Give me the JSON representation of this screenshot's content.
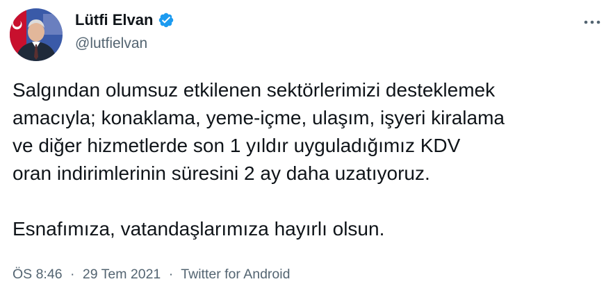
{
  "author": {
    "name": "Lütfi Elvan",
    "handle": "@lutfielvan",
    "verified_color": "#1d9bf0"
  },
  "tweet": {
    "paragraph_1": "Salgından olumsuz etkilenen sektörlerimizi desteklemek\namacıyla; konaklama, yeme-içme, ulaşım, işyeri kiralama\nve diğer hizmetlerde son 1 yıldır uyguladığımız KDV\noran indirimlerinin süresini 2 ay daha uzatıyoruz.",
    "paragraph_2": "Esnafımıza, vatandaşlarımıza hayırlı olsun."
  },
  "meta": {
    "time": "ÖS 8:46",
    "separator": "·",
    "date": "29 Tem 2021",
    "source": "Twitter for Android"
  },
  "icons": {
    "verified": "verified-badge-icon",
    "more": "more-options-icon"
  }
}
